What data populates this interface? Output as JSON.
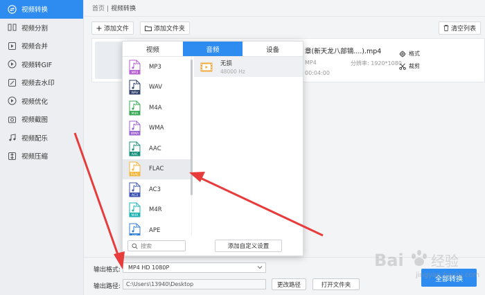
{
  "sidebar": {
    "items": [
      {
        "label": "视频转换",
        "icon": "convert-icon",
        "active": true
      },
      {
        "label": "视频分割",
        "icon": "split-icon",
        "active": false
      },
      {
        "label": "视频合并",
        "icon": "merge-icon",
        "active": false
      },
      {
        "label": "视频转GIF",
        "icon": "gif-icon",
        "active": false
      },
      {
        "label": "视频去水印",
        "icon": "watermark-remove-icon",
        "active": false
      },
      {
        "label": "视频优化",
        "icon": "optimize-icon",
        "active": false
      },
      {
        "label": "视频截图",
        "icon": "screenshot-icon",
        "active": false
      },
      {
        "label": "视频配乐",
        "icon": "music-icon",
        "active": false
      },
      {
        "label": "视频压缩",
        "icon": "compress-icon",
        "active": false
      }
    ]
  },
  "breadcrumb": {
    "home": "首页",
    "separator": "|",
    "current": "视频转换"
  },
  "toolbar": {
    "add_file": "添加文件",
    "add_folder": "添加文件夹",
    "clear_list": "清空列表"
  },
  "file": {
    "name": "章(新天龙八部镝....).mp4",
    "format": "MP4",
    "resolution": "分辨率: 1920*1080",
    "duration": "00:04:00",
    "format_action": "格式",
    "trim_action": "裁剪"
  },
  "popup": {
    "tabs": [
      {
        "label": "视频",
        "active": false
      },
      {
        "label": "音频",
        "active": true
      },
      {
        "label": "设备",
        "active": false
      }
    ],
    "formats": [
      {
        "label": "MP3",
        "tag": "MP3",
        "color": "#b65fd3",
        "selected": false
      },
      {
        "label": "WAV",
        "tag": "WAV",
        "color": "#2d3f6b",
        "selected": false
      },
      {
        "label": "M4A",
        "tag": "M4A",
        "color": "#38a853",
        "selected": false
      },
      {
        "label": "WMA",
        "tag": "WMA",
        "color": "#9a5fd0",
        "selected": false
      },
      {
        "label": "AAC",
        "tag": "AAC",
        "color": "#17907e",
        "selected": false
      },
      {
        "label": "FLAC",
        "tag": "FLAC",
        "color": "#f4b63a",
        "selected": true
      },
      {
        "label": "AC3",
        "tag": "AC3",
        "color": "#3e54b4",
        "selected": false
      },
      {
        "label": "M4R",
        "tag": "M4R",
        "color": "#1bb3b3",
        "selected": false
      },
      {
        "label": "APE",
        "tag": "APE",
        "color": "#2f7fd6",
        "selected": false
      }
    ],
    "search_placeholder": "搜索",
    "quality": {
      "name": "无损",
      "detail": "48000 Hz"
    },
    "add_custom": "添加自定义设置"
  },
  "bottom": {
    "output_format_label": "输出格式:",
    "output_format_value": "MP4  HD 1080P",
    "output_path_label": "输出路径:",
    "output_path_value": "C:\\Users\\13940\\Desktop",
    "change_path": "更改路径",
    "open_folder": "打开文件夹",
    "convert_all": "全部转换"
  },
  "watermark": {
    "text": "jingyan.baidu.com",
    "logo": "Bai经验"
  },
  "colors": {
    "accent": "#2e8cf0",
    "annotation": "#e83b3b"
  }
}
